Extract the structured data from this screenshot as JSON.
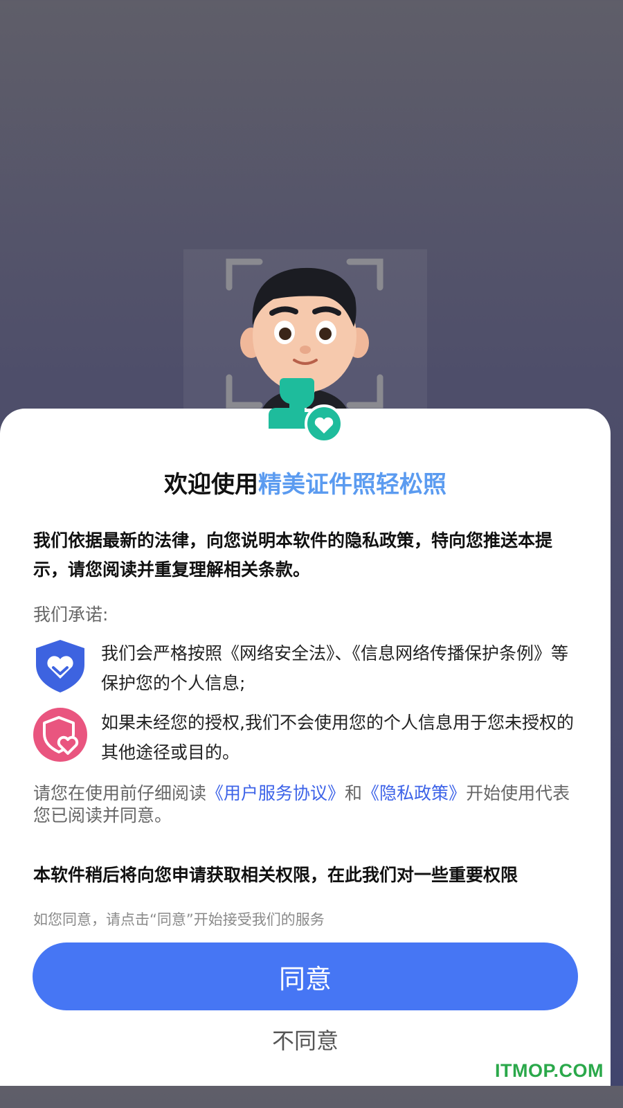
{
  "sheet": {
    "title_prefix": "欢迎使用",
    "title_app_name": "精美证件照轻松照",
    "intro": "我们依据最新的法律，向您说明本软件的隐私政策，特向您推送本提示，请您阅读并重复理解相关条款。",
    "promise_label": "我们承诺:",
    "promises": [
      {
        "icon": "blue-shield-heart-icon",
        "text": "我们会严格按照《网络安全法》、《信息网络传播保护条例》等保护您的个人信息;"
      },
      {
        "icon": "pink-shield-heart-icon",
        "text": "如果未经您的授权,我们不会使用您的个人信息用于您未授权的其他途径或目的。"
      }
    ],
    "notice": {
      "before": "请您在使用前仔细阅读",
      "link_user_agreement": "《用户服务协议》",
      "and": "和",
      "link_privacy_policy": "《隐私政策》",
      "after": "开始使用代表您已阅读并同意。"
    },
    "permissions_text": "本软件稍后将向您申请获取相关权限，在此我们对一些重要权限",
    "hint": "如您同意，请点击“同意”开始接受我们的服务",
    "agree_label": "同意",
    "disagree_label": "不同意"
  },
  "watermark": "ITMOP.COM",
  "colors": {
    "accent_title": "#5b9bf0",
    "primary_button": "#4676f4",
    "link": "#3d63e8",
    "badge_teal": "#1ebc9c",
    "watermark": "#2aa84a"
  }
}
